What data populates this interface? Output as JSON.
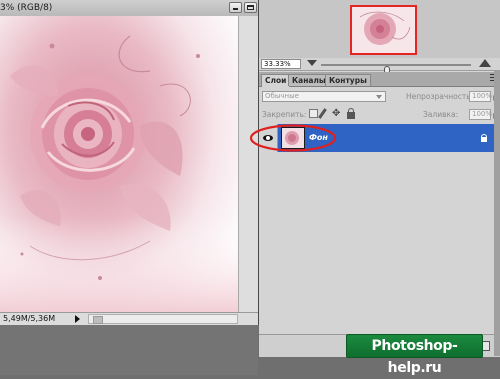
{
  "document": {
    "title": "3% (RGB/8)",
    "status_text": "5,49M/5,36M"
  },
  "navigator": {
    "zoom_value": "33.33%",
    "zoom_slider_level": 0.44
  },
  "layers_panel": {
    "tabs": [
      {
        "label": "Слои",
        "active": true
      },
      {
        "label": "Каналы",
        "active": false
      },
      {
        "label": "Контуры",
        "active": false
      }
    ],
    "blend_mode": "Обычные",
    "opacity_label": "Непрозрачность:",
    "opacity_value": "100%",
    "lock_label": "Закрепить:",
    "fill_label": "Заливка:",
    "fill_value": "100%",
    "layers": [
      {
        "name": "Фон",
        "visible": true,
        "selected": true,
        "locked": true
      }
    ]
  },
  "annotation": {
    "circle_color": "#e0201f"
  },
  "watermark": {
    "text": "Photoshop-help.ru"
  },
  "colors": {
    "selection_blue": "#2f64c4",
    "watermark_green": "#1b8a3e",
    "highlight_red": "#e32525"
  }
}
